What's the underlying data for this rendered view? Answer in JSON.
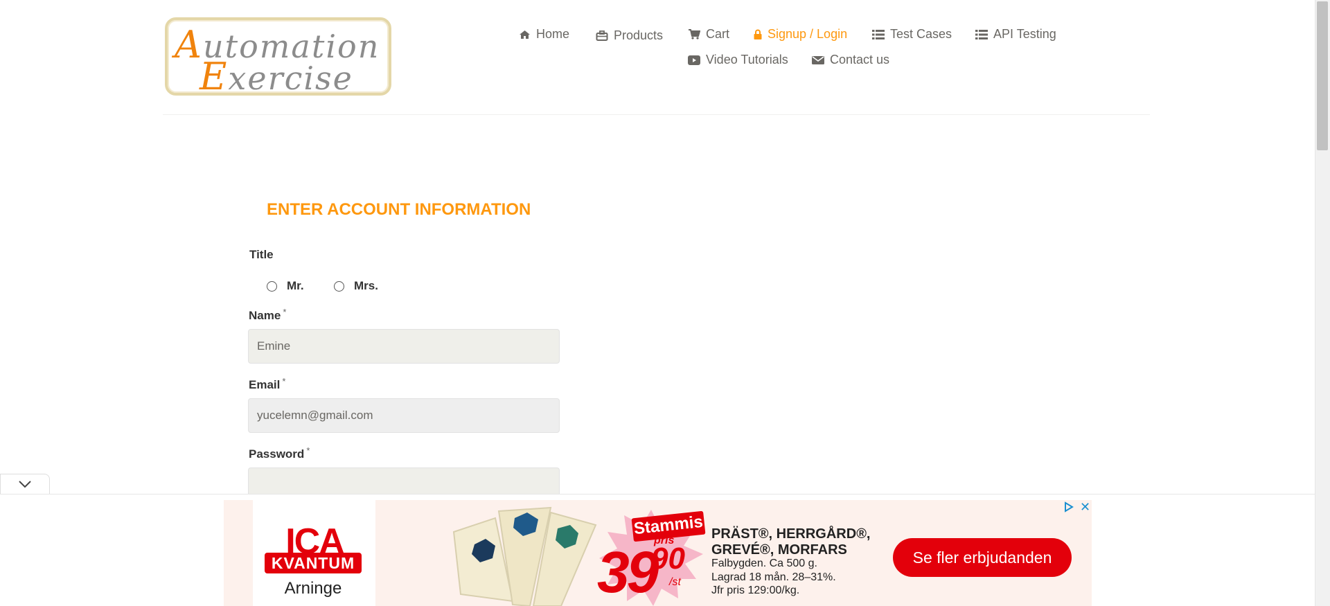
{
  "brand": {
    "logo_line1_cap": "A",
    "logo_line1_rest": "utomation",
    "logo_line2_cap": "E",
    "logo_line2_rest": "xercise"
  },
  "nav": {
    "home": "Home",
    "products": "Products",
    "cart": "Cart",
    "signup_login": "Signup / Login",
    "test_cases": "Test Cases",
    "api_testing": "API Testing",
    "video_tutorials": "Video Tutorials",
    "contact_us": "Contact us",
    "active_item": "Signup / Login",
    "active_color": "#fe980f"
  },
  "form": {
    "heading": "ENTER ACCOUNT INFORMATION",
    "title_label": "Title",
    "title_options": [
      "Mr.",
      "Mrs."
    ],
    "title_selected": null,
    "name_label": "Name",
    "name_value": "Emine",
    "email_label": "Email",
    "email_value": "yucelemn@gmail.com",
    "password_label": "Password",
    "password_value": "",
    "required_mark": "*"
  },
  "ad": {
    "brand_top": "ICA",
    "brand_bottom": "KVANTUM",
    "store": "Arninge",
    "badge": "Stammis",
    "badge_sub": "pris",
    "price_main": "39",
    "price_decimals": "90",
    "price_unit": "/st",
    "product_line1": "PRÄST®, HERRGÅRD®,",
    "product_line2": "GREVÉ®, MORFARS",
    "desc_line1": "Falbygden. Ca 500 g.",
    "desc_line2": "Lagrad 18 mån. 28–31%.",
    "desc_line3": "Jfr pris 129:00/kg.",
    "cta": "Se fler erbjudanden",
    "close_glyph": "✕",
    "brand_color": "#e3000b"
  }
}
